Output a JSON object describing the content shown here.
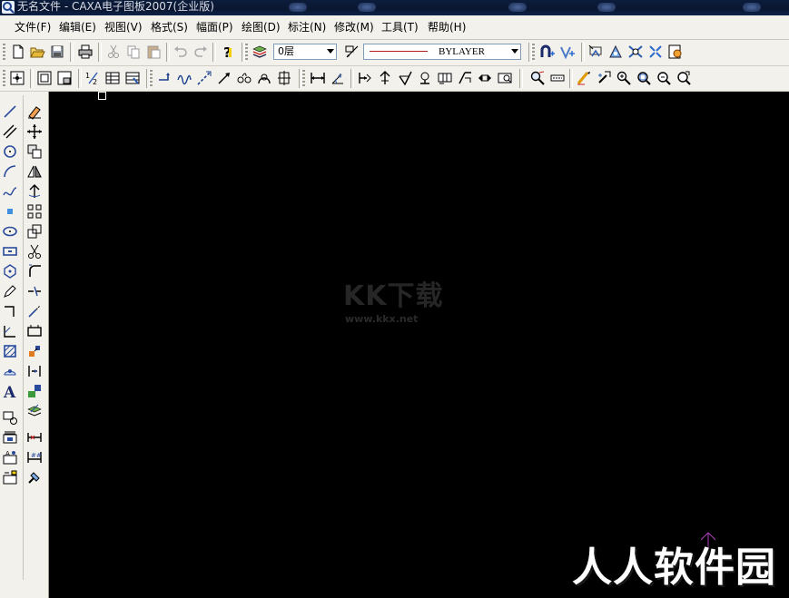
{
  "window": {
    "title": "无名文件 - CAXA电子图板2007(企业版)"
  },
  "menu": [
    "文件(F)",
    "编辑(E)",
    "视图(V)",
    "格式(S)",
    "幅面(P)",
    "绘图(D)",
    "标注(N)",
    "修改(M)",
    "工具(T)",
    "帮助(H)"
  ],
  "toolbar": {
    "layer_value": "0层",
    "linetype_value": "BYLAYER"
  },
  "canvas": {
    "watermark_logo": "KK下载",
    "watermark_url": "www.kkx.net",
    "brand_watermark": "人人软件园"
  },
  "colors": {
    "canvas_background": "#000000",
    "ucs_arrow": "#b040c0",
    "linetype_sample": "#b51c1c"
  }
}
